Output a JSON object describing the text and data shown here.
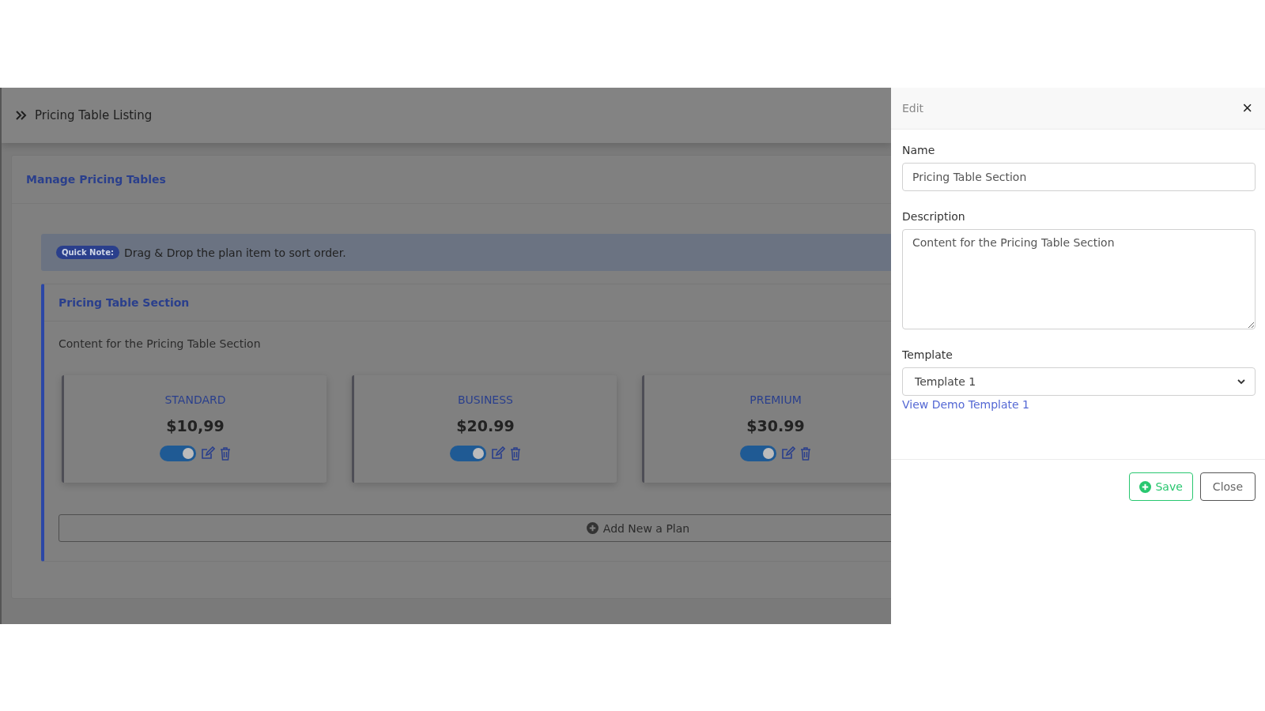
{
  "header": {
    "title": "Pricing Table Listing"
  },
  "card": {
    "title": "Manage Pricing Tables"
  },
  "note": {
    "badge": "Quick Note:",
    "text": "Drag & Drop the plan item to sort order."
  },
  "section": {
    "title": "Pricing Table Section",
    "description": "Content for the Pricing Table Section",
    "plans": [
      {
        "name": "STANDARD",
        "price": "$10,99",
        "enabled": true
      },
      {
        "name": "BUSINESS",
        "price": "$20.99",
        "enabled": true
      },
      {
        "name": "PREMIUM",
        "price": "$30.99",
        "enabled": true
      }
    ],
    "add_button": "Add New a Plan"
  },
  "drawer": {
    "title": "Edit",
    "close_glyph": "×",
    "fields": [
      {
        "kind": "input",
        "label": "Name",
        "value": "Pricing Table Section"
      },
      {
        "kind": "textarea",
        "label": "Description",
        "value": "Content for the Pricing Table Section"
      },
      {
        "kind": "select",
        "label": "Template",
        "value": "Template 1"
      }
    ],
    "link": "View Demo Template 1",
    "buttons": [
      {
        "kind": "save",
        "label": "Save"
      },
      {
        "kind": "close",
        "label": "Close"
      }
    ]
  }
}
